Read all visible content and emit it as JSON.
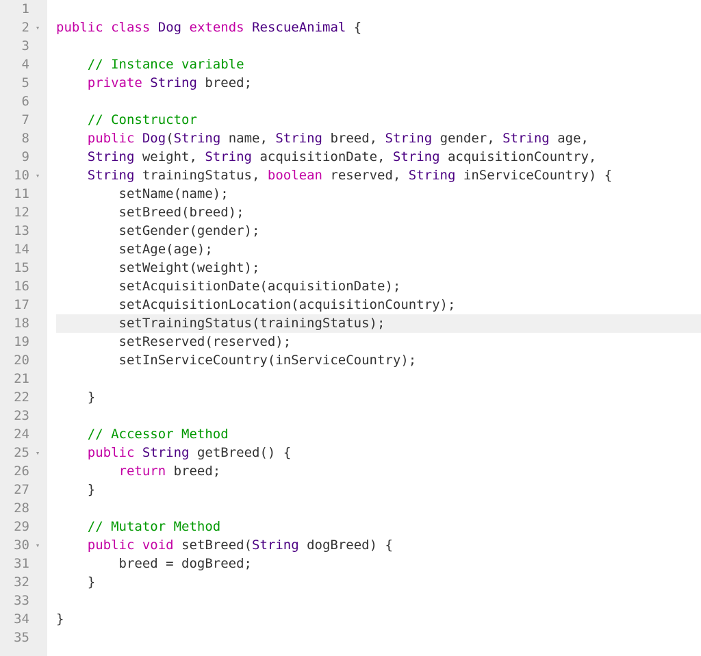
{
  "highlighted_line": 18,
  "fold_lines": [
    2,
    10,
    25,
    30
  ],
  "fold_marker": "▾",
  "lines": [
    {
      "n": 1,
      "tokens": []
    },
    {
      "n": 2,
      "tokens": [
        {
          "t": "public",
          "c": "kw"
        },
        {
          "t": " ",
          "c": "pln"
        },
        {
          "t": "class",
          "c": "kw"
        },
        {
          "t": " ",
          "c": "pln"
        },
        {
          "t": "Dog",
          "c": "type"
        },
        {
          "t": " ",
          "c": "pln"
        },
        {
          "t": "extends",
          "c": "kw"
        },
        {
          "t": " ",
          "c": "pln"
        },
        {
          "t": "RescueAnimal",
          "c": "type"
        },
        {
          "t": " {",
          "c": "pln"
        }
      ]
    },
    {
      "n": 3,
      "tokens": []
    },
    {
      "n": 4,
      "tokens": [
        {
          "t": "    ",
          "c": "pln"
        },
        {
          "t": "// Instance variable",
          "c": "cmt"
        }
      ]
    },
    {
      "n": 5,
      "tokens": [
        {
          "t": "    ",
          "c": "pln"
        },
        {
          "t": "private",
          "c": "kw"
        },
        {
          "t": " ",
          "c": "pln"
        },
        {
          "t": "String",
          "c": "type"
        },
        {
          "t": " breed;",
          "c": "pln"
        }
      ]
    },
    {
      "n": 6,
      "tokens": []
    },
    {
      "n": 7,
      "tokens": [
        {
          "t": "    ",
          "c": "pln"
        },
        {
          "t": "// Constructor",
          "c": "cmt"
        }
      ]
    },
    {
      "n": 8,
      "tokens": [
        {
          "t": "    ",
          "c": "pln"
        },
        {
          "t": "public",
          "c": "kw"
        },
        {
          "t": " ",
          "c": "pln"
        },
        {
          "t": "Dog",
          "c": "type"
        },
        {
          "t": "(",
          "c": "pln"
        },
        {
          "t": "String",
          "c": "type"
        },
        {
          "t": " name, ",
          "c": "pln"
        },
        {
          "t": "String",
          "c": "type"
        },
        {
          "t": " breed, ",
          "c": "pln"
        },
        {
          "t": "String",
          "c": "type"
        },
        {
          "t": " gender, ",
          "c": "pln"
        },
        {
          "t": "String",
          "c": "type"
        },
        {
          "t": " age,",
          "c": "pln"
        }
      ]
    },
    {
      "n": 9,
      "tokens": [
        {
          "t": "    ",
          "c": "pln"
        },
        {
          "t": "String",
          "c": "type"
        },
        {
          "t": " weight, ",
          "c": "pln"
        },
        {
          "t": "String",
          "c": "type"
        },
        {
          "t": " acquisitionDate, ",
          "c": "pln"
        },
        {
          "t": "String",
          "c": "type"
        },
        {
          "t": " acquisitionCountry,",
          "c": "pln"
        }
      ]
    },
    {
      "n": 10,
      "tokens": [
        {
          "t": "    ",
          "c": "pln"
        },
        {
          "t": "String",
          "c": "type"
        },
        {
          "t": " trainingStatus, ",
          "c": "pln"
        },
        {
          "t": "boolean",
          "c": "kw"
        },
        {
          "t": " reserved, ",
          "c": "pln"
        },
        {
          "t": "String",
          "c": "type"
        },
        {
          "t": " inServiceCountry) {",
          "c": "pln"
        }
      ]
    },
    {
      "n": 11,
      "tokens": [
        {
          "t": "        setName(name);",
          "c": "pln"
        }
      ]
    },
    {
      "n": 12,
      "tokens": [
        {
          "t": "        setBreed(breed);",
          "c": "pln"
        }
      ]
    },
    {
      "n": 13,
      "tokens": [
        {
          "t": "        setGender(gender);",
          "c": "pln"
        }
      ]
    },
    {
      "n": 14,
      "tokens": [
        {
          "t": "        setAge(age);",
          "c": "pln"
        }
      ]
    },
    {
      "n": 15,
      "tokens": [
        {
          "t": "        setWeight(weight);",
          "c": "pln"
        }
      ]
    },
    {
      "n": 16,
      "tokens": [
        {
          "t": "        setAcquisitionDate(acquisitionDate);",
          "c": "pln"
        }
      ]
    },
    {
      "n": 17,
      "tokens": [
        {
          "t": "        setAcquisitionLocation(acquisitionCountry);",
          "c": "pln"
        }
      ]
    },
    {
      "n": 18,
      "tokens": [
        {
          "t": "        setTrainingStatus(trainingStatus);",
          "c": "pln"
        }
      ]
    },
    {
      "n": 19,
      "tokens": [
        {
          "t": "        setReserved(reserved);",
          "c": "pln"
        }
      ]
    },
    {
      "n": 20,
      "tokens": [
        {
          "t": "        setInServiceCountry(inServiceCountry);",
          "c": "pln"
        }
      ]
    },
    {
      "n": 21,
      "tokens": []
    },
    {
      "n": 22,
      "tokens": [
        {
          "t": "    }",
          "c": "pln"
        }
      ]
    },
    {
      "n": 23,
      "tokens": []
    },
    {
      "n": 24,
      "tokens": [
        {
          "t": "    ",
          "c": "pln"
        },
        {
          "t": "// Accessor Method",
          "c": "cmt"
        }
      ]
    },
    {
      "n": 25,
      "tokens": [
        {
          "t": "    ",
          "c": "pln"
        },
        {
          "t": "public",
          "c": "kw"
        },
        {
          "t": " ",
          "c": "pln"
        },
        {
          "t": "String",
          "c": "type"
        },
        {
          "t": " getBreed() {",
          "c": "pln"
        }
      ]
    },
    {
      "n": 26,
      "tokens": [
        {
          "t": "        ",
          "c": "pln"
        },
        {
          "t": "return",
          "c": "kw"
        },
        {
          "t": " breed;",
          "c": "pln"
        }
      ]
    },
    {
      "n": 27,
      "tokens": [
        {
          "t": "    }",
          "c": "pln"
        }
      ]
    },
    {
      "n": 28,
      "tokens": []
    },
    {
      "n": 29,
      "tokens": [
        {
          "t": "    ",
          "c": "pln"
        },
        {
          "t": "// Mutator Method",
          "c": "cmt"
        }
      ]
    },
    {
      "n": 30,
      "tokens": [
        {
          "t": "    ",
          "c": "pln"
        },
        {
          "t": "public",
          "c": "kw"
        },
        {
          "t": " ",
          "c": "pln"
        },
        {
          "t": "void",
          "c": "kw"
        },
        {
          "t": " setBreed(",
          "c": "pln"
        },
        {
          "t": "String",
          "c": "type"
        },
        {
          "t": " dogBreed) {",
          "c": "pln"
        }
      ]
    },
    {
      "n": 31,
      "tokens": [
        {
          "t": "        breed = dogBreed;",
          "c": "pln"
        }
      ]
    },
    {
      "n": 32,
      "tokens": [
        {
          "t": "    }",
          "c": "pln"
        }
      ]
    },
    {
      "n": 33,
      "tokens": []
    },
    {
      "n": 34,
      "tokens": [
        {
          "t": "}",
          "c": "pln"
        }
      ]
    },
    {
      "n": 35,
      "tokens": []
    }
  ]
}
